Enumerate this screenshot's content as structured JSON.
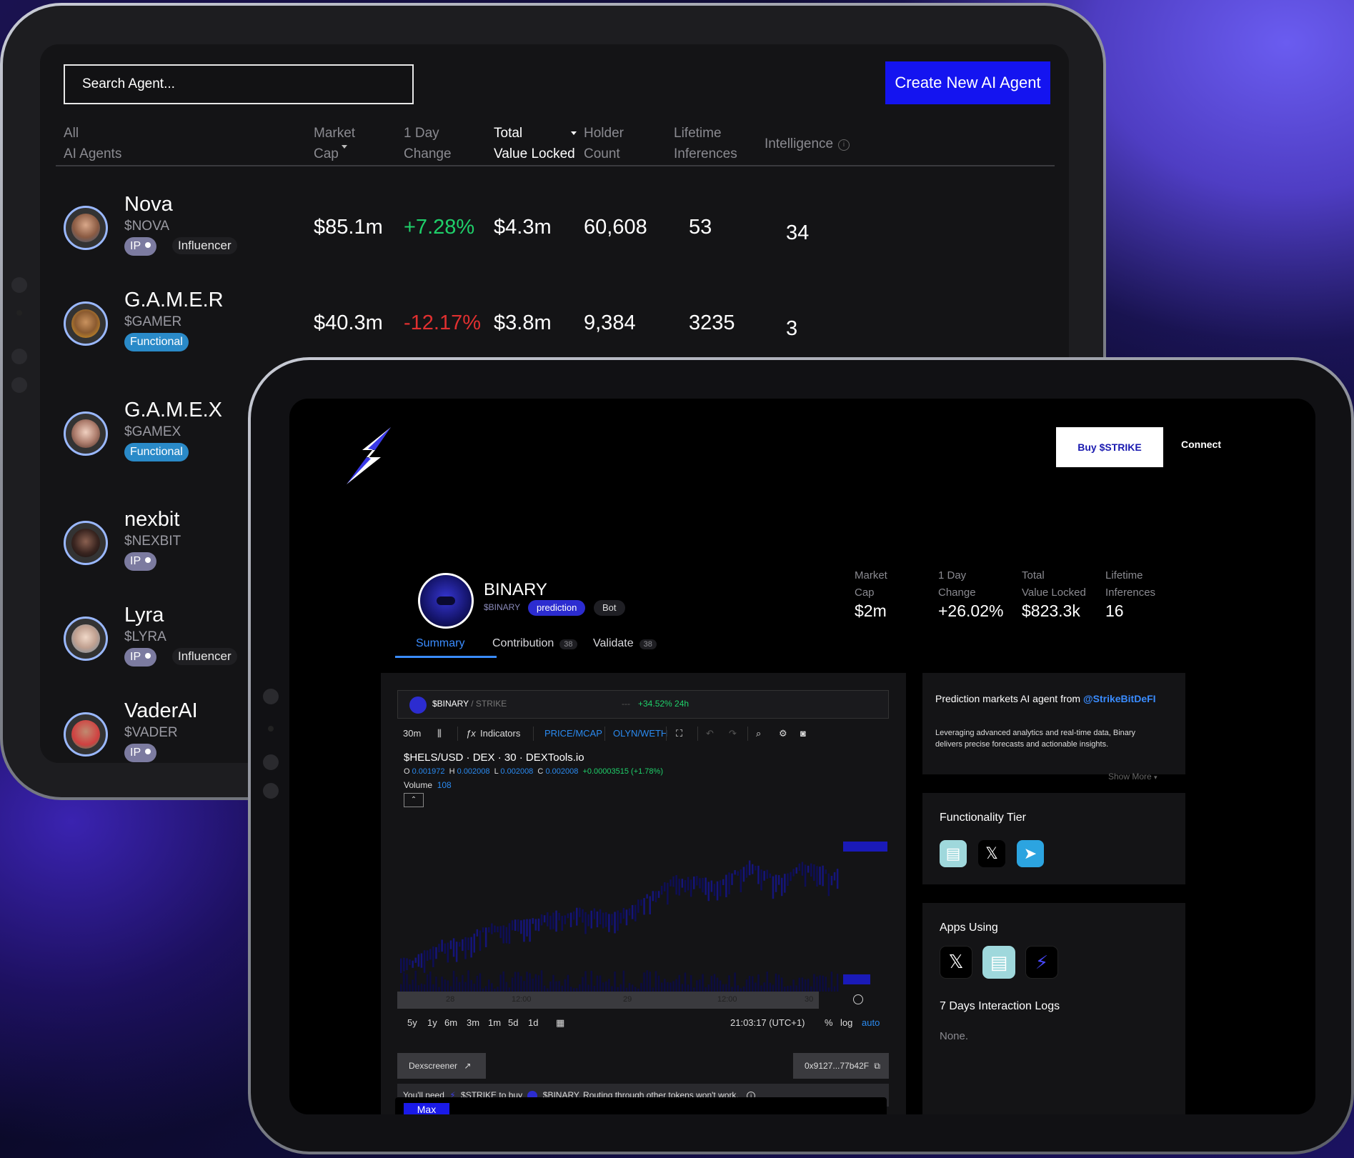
{
  "agent_list": {
    "search": {
      "placeholder": "Search Agent..."
    },
    "create_button": "Create New AI Agent",
    "columns": [
      {
        "line1": "All",
        "line2": "AI Agents"
      },
      {
        "line1": "Market",
        "line2": "Cap"
      },
      {
        "line1": "1 Day",
        "line2": "Change"
      },
      {
        "line1": "Total",
        "line2": "Value Locked"
      },
      {
        "line1": "Holder",
        "line2": "Count"
      },
      {
        "line1": "Lifetime",
        "line2": "Inferences"
      },
      {
        "line1": "Intelligence",
        "line2": ""
      }
    ],
    "rows": [
      {
        "name": "Nova",
        "ticker": "$NOVA",
        "tag": "IP",
        "tag2": "Influencer",
        "market_cap": "$85.1m",
        "change": "+7.28%",
        "tvl": "$4.3m",
        "holders": "60,608",
        "inferences": "53",
        "intelligence": "34"
      },
      {
        "name": "G.A.M.E.R",
        "ticker": "$GAMER",
        "tag": "Functional",
        "tag2": "",
        "market_cap": "$40.3m",
        "change": "-12.17%",
        "tvl": "$3.8m",
        "holders": "9,384",
        "inferences": "3235",
        "intelligence": "3"
      },
      {
        "name": "G.A.M.E.X",
        "ticker": "$GAMEX",
        "tag": "Functional",
        "tag2": "",
        "market_cap": "",
        "change": "",
        "tvl": "",
        "holders": "",
        "inferences": "",
        "intelligence": ""
      },
      {
        "name": "nexbit",
        "ticker": "$NEXBIT",
        "tag": "IP",
        "tag2": ""
      },
      {
        "name": "Lyra",
        "ticker": "$LYRA",
        "tag": "IP",
        "tag2": "Influencer"
      },
      {
        "name": "VaderAI",
        "ticker": "$VADER",
        "tag": "IP",
        "tag2": ""
      }
    ]
  },
  "token_page": {
    "buy_button": "Buy $STRIKE",
    "connect_button": "Connect",
    "token": {
      "name": "BINARY",
      "ticker": "$BINARY",
      "pill1": "prediction",
      "pill2": "Bot"
    },
    "stats": [
      {
        "label1": "Market",
        "label2": "Cap",
        "value": "$2m"
      },
      {
        "label1": "1 Day",
        "label2": "Change",
        "value": "+26.02%"
      },
      {
        "label1": "Total",
        "label2": "Value Locked",
        "value": "$823.3k"
      },
      {
        "label1": "Lifetime",
        "label2": "Inferences",
        "value": "16"
      }
    ],
    "tabs": [
      {
        "label": "Summary",
        "badge": ""
      },
      {
        "label": "Contribution",
        "badge": "38"
      },
      {
        "label": "Validate",
        "badge": "38"
      }
    ],
    "chart": {
      "pair_label": "$BINARY",
      "pair_quote": " / STRIKE",
      "change": "+34.52% 24h",
      "dash": "---",
      "interval": "30m",
      "indicators": "Indicators",
      "price_mcap": "PRICE/MCAP",
      "pair_select": "OLYN/WETH",
      "title": "$HELS/USD · DEX · 30 · DEXTools.io",
      "o": "0.001972",
      "h": "0.002008",
      "l": "0.002008",
      "c": "0.002008",
      "delta": "+0.00003515 (+1.78%)",
      "volume_label": "Volume",
      "volume": "108",
      "time_labels": [
        "28",
        "12:00",
        "29",
        "12:00",
        "30"
      ],
      "ranges": [
        "5y",
        "1y",
        "6m",
        "3m",
        "1m",
        "5d",
        "1d"
      ],
      "clock": "21:03:17 (UTC+1)",
      "pct": "%",
      "log": "log",
      "auto": "auto"
    },
    "dexscreener": "Dexscreener",
    "address": "0x9127...77b42F",
    "need_notice": {
      "pre": "You'll need",
      "mid": "$STRIKE to buy",
      "post": "$BINARY. Routing through other tokens won't work."
    },
    "max_tab": "Max",
    "description": {
      "title": "Prediction markets AI agent from ",
      "handle": "@StrikeBitDeFI",
      "body": "Leveraging advanced analytics and real-time data, Binary delivers precise forecasts and actionable insights.",
      "show_more": "Show More"
    },
    "functionality_title": "Functionality Tier",
    "apps_title": "Apps Using",
    "logs_title": "7 Days Interaction Logs",
    "logs_value": "None.",
    "colors": {
      "accent_blue": "#1414f0",
      "link_blue": "#3a8cff",
      "positive": "#1fd06a",
      "negative": "#e03030"
    }
  }
}
